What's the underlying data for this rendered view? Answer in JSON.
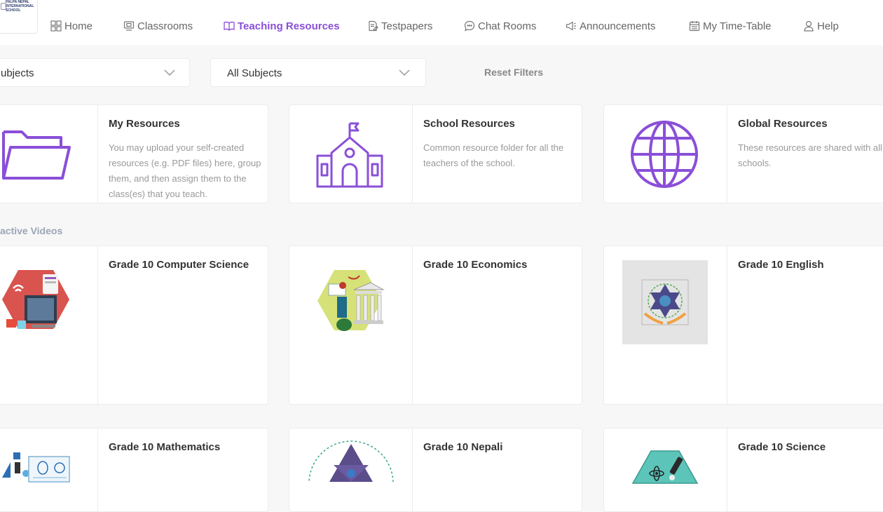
{
  "logo": {
    "lines": [
      "PALPA NEPAL",
      "INTERNATIONAL",
      "SCHOOL"
    ]
  },
  "nav": [
    {
      "label": "Home",
      "icon": "grid-icon",
      "active": false
    },
    {
      "label": "Classrooms",
      "icon": "classroom-icon",
      "active": false
    },
    {
      "label": "Teaching Resources",
      "icon": "book-icon",
      "active": true
    },
    {
      "label": "Testpapers",
      "icon": "testpaper-icon",
      "active": false
    },
    {
      "label": "Chat Rooms",
      "icon": "chat-icon",
      "active": false
    },
    {
      "label": "Announcements",
      "icon": "megaphone-icon",
      "active": false
    },
    {
      "label": "My Time-Table",
      "icon": "calendar-icon",
      "active": false
    },
    {
      "label": "Help",
      "icon": "user-help-icon",
      "active": false
    }
  ],
  "filters": {
    "first_select": "ubjects",
    "second_select": "All Subjects",
    "reset": "Reset Filters"
  },
  "resources": [
    {
      "title": "My Resources",
      "desc": "You may upload your self-created resources (e.g. PDF files) here, group them, and then assign them to the class(es) that you teach."
    },
    {
      "title": "School Resources",
      "desc": "Common resource folder for all the teachers of the school."
    },
    {
      "title": "Global Resources",
      "desc": "These resources are shared with all schools."
    }
  ],
  "section_label": "active Videos",
  "videos": [
    {
      "title": "Grade 10 Computer Science"
    },
    {
      "title": "Grade 10 Economics"
    },
    {
      "title": "Grade 10 English"
    },
    {
      "title": "Grade 10 Mathematics"
    },
    {
      "title": "Grade 10 Nepali"
    },
    {
      "title": "Grade 10 Science"
    }
  ],
  "colors": {
    "accent": "#8a4fd8",
    "muted": "#999999",
    "section": "#9aa6b5"
  }
}
